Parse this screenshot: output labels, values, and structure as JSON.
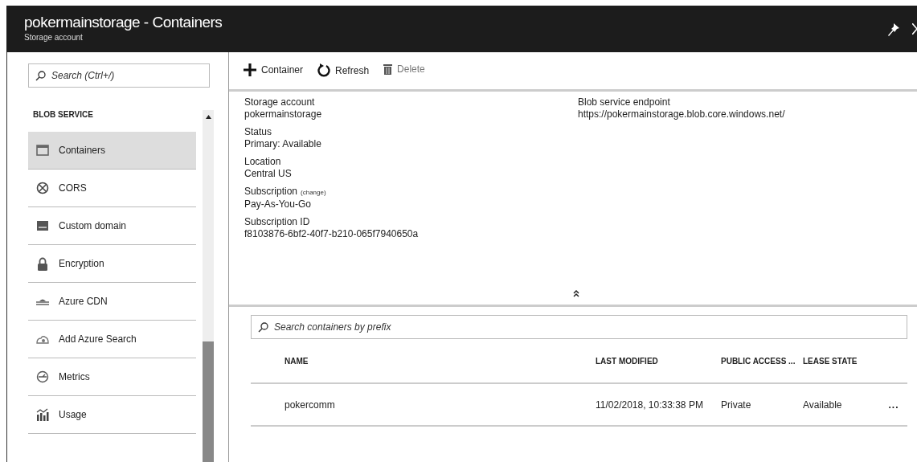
{
  "window": {
    "title": "pokermainstorage - Containers",
    "subtitle": "Storage account"
  },
  "sidebar": {
    "search": {
      "placeholder": "Search (Ctrl+/)"
    },
    "section": "BLOB SERVICE",
    "items": [
      {
        "label": "Containers",
        "selected": true
      },
      {
        "label": "CORS",
        "selected": false
      },
      {
        "label": "Custom domain",
        "selected": false
      },
      {
        "label": "Encryption",
        "selected": false
      },
      {
        "label": "Azure CDN",
        "selected": false
      },
      {
        "label": "Add Azure Search",
        "selected": false
      },
      {
        "label": "Metrics",
        "selected": false
      },
      {
        "label": "Usage",
        "selected": false
      }
    ]
  },
  "toolbar": [
    {
      "kind": "add",
      "label": "Container",
      "disabled": false
    },
    {
      "kind": "refresh",
      "label": "Refresh",
      "disabled": false
    },
    {
      "kind": "delete",
      "label": "Delete",
      "disabled": true
    }
  ],
  "essentials": {
    "left": [
      {
        "label": "Storage account",
        "value": "pokermainstorage"
      },
      {
        "label": "Status",
        "value": "Primary: Available"
      },
      {
        "label": "Location",
        "value": "Central US"
      },
      {
        "label": "Subscription",
        "link": "(change)",
        "value": "Pay-As-You-Go"
      },
      {
        "label": "Subscription ID",
        "value": "f8103876-6bf2-40f7-b210-065f7940650a"
      }
    ],
    "right": [
      {
        "label": "Blob service endpoint",
        "value": "https://pokermainstorage.blob.core.windows.net/"
      }
    ]
  },
  "containers": {
    "search": {
      "placeholder": "Search containers by prefix"
    },
    "columns": [
      "NAME",
      "LAST MODIFIED",
      "PUBLIC ACCESS ...",
      "LEASE STATE"
    ],
    "rows": [
      {
        "cells": [
          "pokercomm",
          "11/02/2018, 10:33:38 PM",
          "Private",
          "Available"
        ],
        "more": "..."
      }
    ]
  }
}
